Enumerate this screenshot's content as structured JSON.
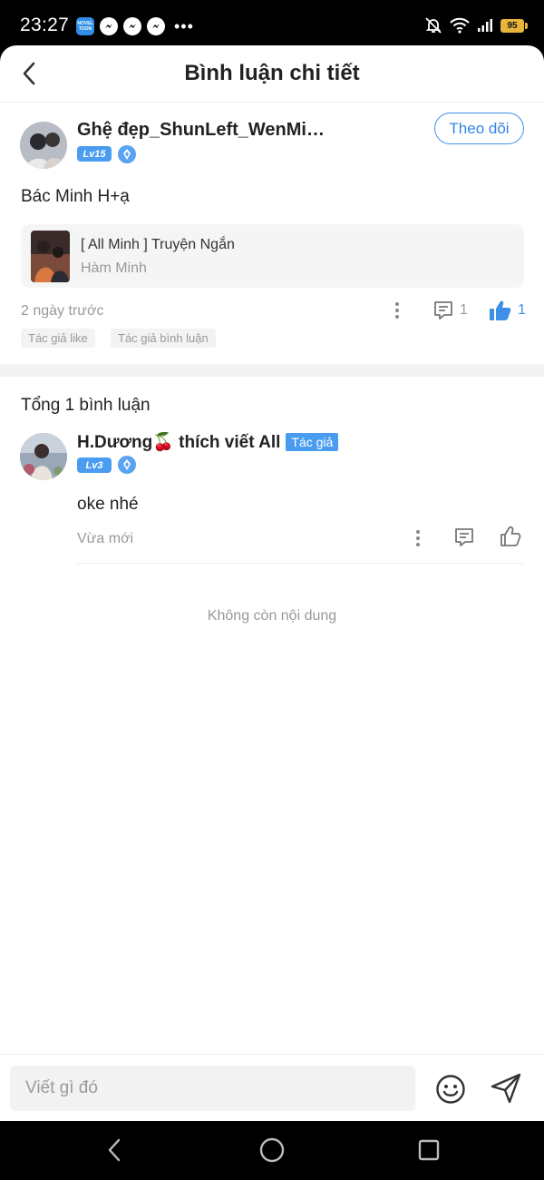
{
  "status_bar": {
    "time": "23:27",
    "app_badge": "NOVEL TOON",
    "more": "•••",
    "battery": "95"
  },
  "header": {
    "title": "Bình luận chi tiết"
  },
  "post": {
    "author_name": "Ghệ đẹp_ShunLeft_WenMing...",
    "level": "Lv15",
    "follow_label": "Theo dõi",
    "text": "Bác Minh H+ạ",
    "linked": {
      "title": "[ All Minh ] Truyện Ngắn",
      "author": "Hàm Minh"
    },
    "time": "2 ngày trước",
    "reply_count": "1",
    "like_count": "1",
    "tags": [
      "Tác giả like",
      "Tác giả bình luận"
    ]
  },
  "comments": {
    "total_label": "Tổng 1 bình luận",
    "items": [
      {
        "name": "H.Dương🍒 thích viết All",
        "author_tag": "Tác giả",
        "level": "Lv3",
        "text": "oke nhé",
        "time": "Vừa mới"
      }
    ],
    "end_text": "Không còn nội dung"
  },
  "input": {
    "placeholder": "Viết gì đó"
  },
  "colors": {
    "accent": "#3f93ec",
    "badge": "#4a9cf0",
    "muted": "#999999"
  },
  "icons": [
    "back-arrow-icon",
    "more-vertical-icon",
    "comment-icon",
    "thumbs-up-icon",
    "emoji-icon",
    "send-icon",
    "medal-icon"
  ]
}
